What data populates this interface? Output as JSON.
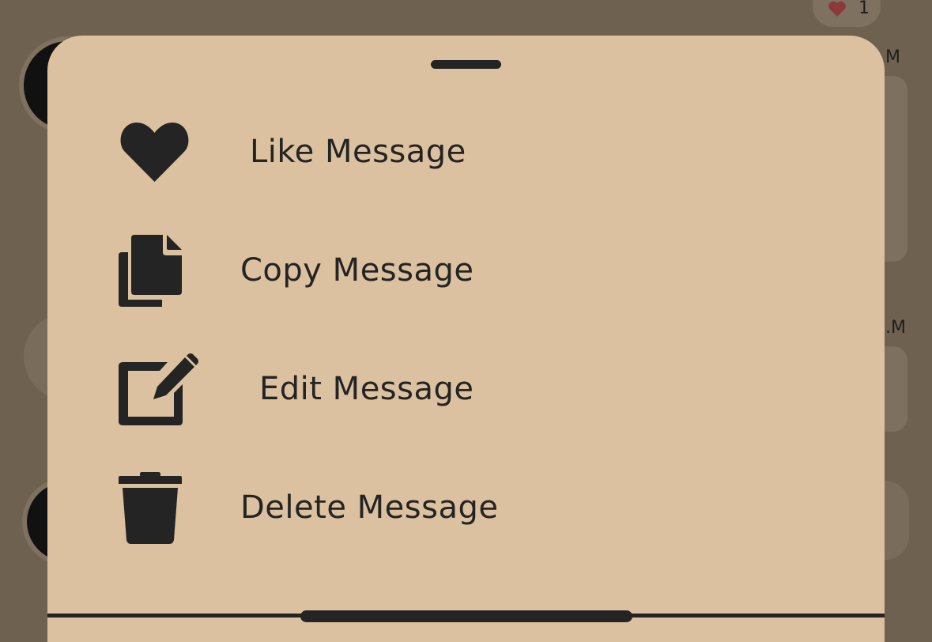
{
  "background": {
    "time_1": "M",
    "time_2": ".M",
    "reaction_count": "1"
  },
  "sheet": {
    "menu": [
      {
        "label": "Like Message",
        "icon": "heart-icon"
      },
      {
        "label": "Copy Message",
        "icon": "copy-icon"
      },
      {
        "label": "Edit Message",
        "icon": "edit-icon"
      },
      {
        "label": "Delete Message",
        "icon": "trash-icon"
      }
    ]
  },
  "colors": {
    "sheet_background": "#dbc19f",
    "overlay_background": "#6f6150",
    "foreground": "#242424",
    "reaction_heart": "#8b3a3a"
  }
}
